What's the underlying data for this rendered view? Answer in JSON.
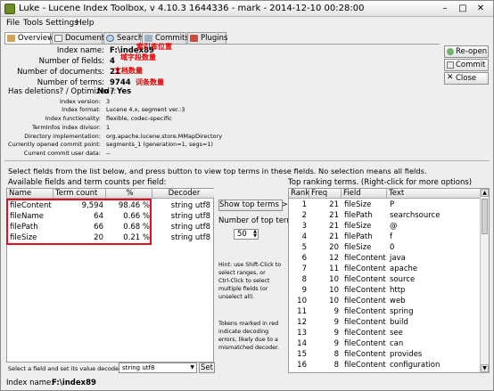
{
  "window": {
    "title": "Luke - Lucene Index Toolbox, v 4.10.3 1644336 - mark - 2014-12-10 00:28:00"
  },
  "menu": [
    "File",
    "Tools",
    "Settings",
    "Help"
  ],
  "tabs": [
    {
      "label": "Overview",
      "icon": "overview-icon"
    },
    {
      "label": "Documents",
      "icon": "documents-icon"
    },
    {
      "label": "Search",
      "icon": "search-icon"
    },
    {
      "label": "Commits",
      "icon": "commits-icon"
    },
    {
      "label": "Plugins",
      "icon": "plugins-icon"
    }
  ],
  "overview": {
    "index_name_label": "Index name:",
    "index_name": "F:\\index89",
    "num_fields_label": "Number of fields:",
    "num_fields": "4",
    "num_docs_label": "Number of documents:",
    "num_docs": "21",
    "num_terms_label": "Number of terms:",
    "num_terms": "9744",
    "deletions_label": "Has deletions? / Optimized?:",
    "deletions": "No / Yes",
    "index_version_label": "Index version:",
    "index_version": "3",
    "index_format_label": "Index format:",
    "index_format": "Lucene 4.x, segment ver.:3",
    "index_functionality_label": "Index functionality:",
    "index_functionality": "flexible, codec-specific",
    "terminfos_label": "TermInfos index divisor:",
    "terminfos": "1",
    "directory_label": "Directory implementation:",
    "directory": "org.apache.lucene.store.MMapDirectory",
    "commit_point_label": "Currently opened commit point:",
    "commit_point": "segments_1 (generation=1, segs=1)",
    "user_data_label": "Current commit user data:",
    "user_data": "--"
  },
  "annotations": {
    "index_location": "索引库位置",
    "field_count": "域字段数量",
    "doc_count": "文档数量",
    "term_count": "词条数量"
  },
  "side_buttons": [
    {
      "label": "Re-open",
      "icon": "reopen-icon"
    },
    {
      "label": "Commit",
      "icon": "commit-icon"
    },
    {
      "label": "Close",
      "icon": "close-icon"
    }
  ],
  "instructions": "Select fields from the list below, and press button to view top terms in these fields. No selection means all fields.",
  "fields_panel": {
    "label": "Available fields and term counts per field:",
    "headers": [
      "Name",
      "Term count",
      "%",
      "Decoder"
    ],
    "rows": [
      [
        "fileContent",
        "9,594",
        "98.46 %",
        "string utf8"
      ],
      [
        "fileName",
        "64",
        "0.66 %",
        "string utf8"
      ],
      [
        "filePath",
        "66",
        "0.68 %",
        "string utf8"
      ],
      [
        "fileSize",
        "20",
        "0.21 %",
        "string utf8"
      ]
    ]
  },
  "middle": {
    "show_top_terms": "Show top terms >>",
    "num_top_terms_label": "Number of top terms:",
    "num_top_terms": "50",
    "hint": "Hint: use Shift-Click to\nselect ranges, or\nCtrl-Click to select\nmultiple fields (or\nunselect all).",
    "tokens_note": "Tokens marked in red\nindicate decoding\nerrors, likely due to a\nmismatched decoder."
  },
  "terms_panel": {
    "label": "Top ranking terms. (Right-click for more options)",
    "headers": [
      "Rank",
      "Freq",
      "Field",
      "Text"
    ],
    "rows": [
      [
        "1",
        "21",
        "fileSize",
        "P"
      ],
      [
        "2",
        "21",
        "filePath",
        "searchsource"
      ],
      [
        "3",
        "21",
        "fileSize",
        "@"
      ],
      [
        "4",
        "21",
        "filePath",
        "f"
      ],
      [
        "5",
        "20",
        "fileSize",
        "0"
      ],
      [
        "6",
        "12",
        "fileContent",
        "java"
      ],
      [
        "7",
        "11",
        "fileContent",
        "apache"
      ],
      [
        "8",
        "10",
        "fileContent",
        "source"
      ],
      [
        "9",
        "10",
        "fileContent",
        "http"
      ],
      [
        "10",
        "10",
        "fileContent",
        "web"
      ],
      [
        "11",
        "9",
        "fileContent",
        "spring"
      ],
      [
        "12",
        "9",
        "fileContent",
        "build"
      ],
      [
        "13",
        "9",
        "fileContent",
        "see"
      ],
      [
        "14",
        "9",
        "fileContent",
        "can"
      ],
      [
        "15",
        "8",
        "fileContent",
        "provides"
      ],
      [
        "16",
        "8",
        "fileContent",
        "configuration"
      ]
    ]
  },
  "decoder": {
    "label": "Select a field and set its value decoder:",
    "value": "string utf8",
    "set_button": "Set"
  },
  "status": {
    "index_name_label": "Index name:",
    "index_name": "F:\\index89"
  },
  "colors": {
    "annotation_red": "#e00000",
    "highlight_rect": "#e01020"
  }
}
